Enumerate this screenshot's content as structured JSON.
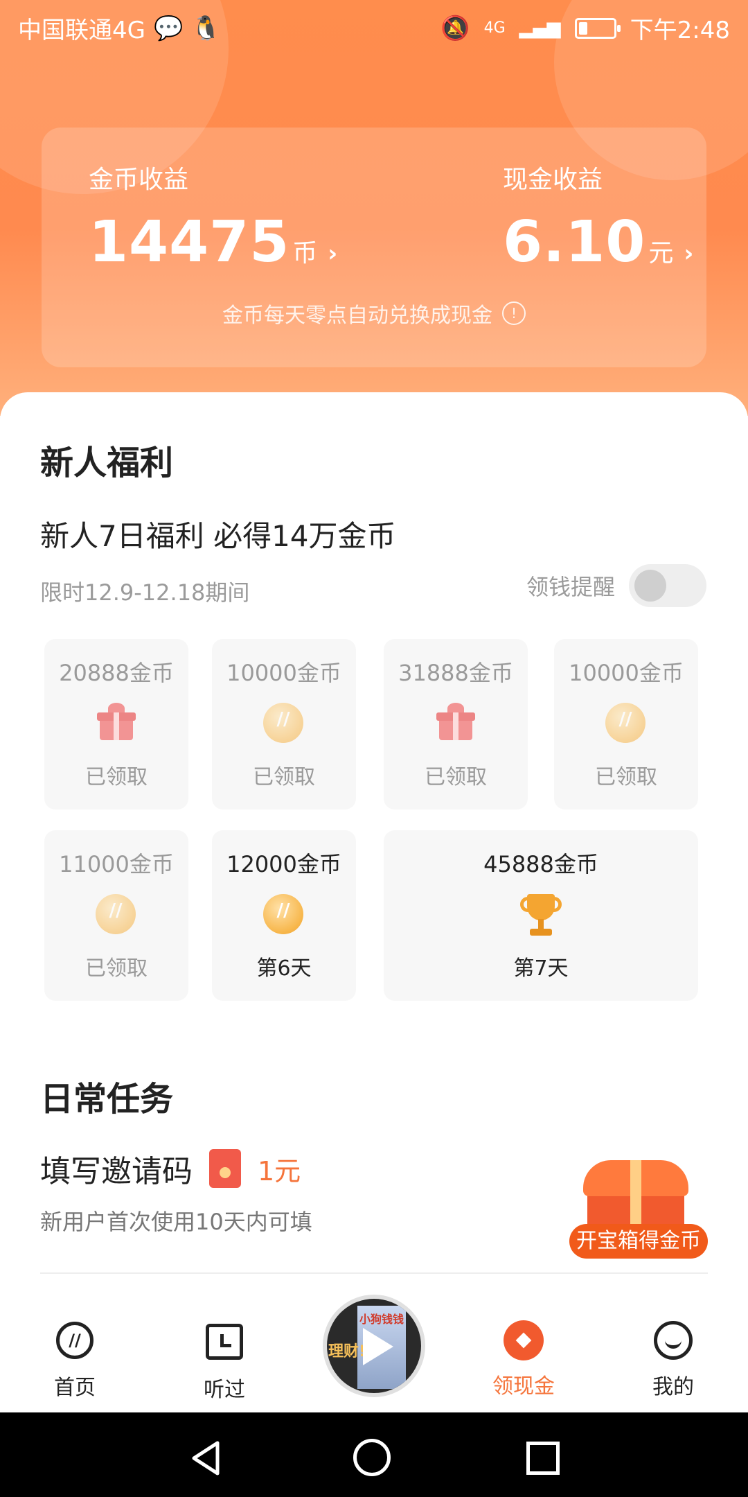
{
  "status_bar": {
    "carrier": "中国联通4G",
    "time": "下午2:48",
    "network": "4G"
  },
  "earnings": {
    "coins": {
      "label": "金币收益",
      "value": "14475",
      "unit": "币",
      "arrow": "›"
    },
    "cash": {
      "label": "现金收益",
      "value": "6.10",
      "unit": "元",
      "arrow": "›"
    },
    "note": "金币每天零点自动兑换成现金",
    "info_icon": "!"
  },
  "newbie": {
    "title": "新人福利",
    "subtitle": "新人7日福利 必得14万金币",
    "period": "限时12.9-12.18期间",
    "remind_label": "领钱提醒",
    "remind_enabled": false,
    "rewards": [
      {
        "amount": "20888金币",
        "status": "已领取",
        "icon": "gift-icon"
      },
      {
        "amount": "10000金币",
        "status": "已领取",
        "icon": "coin-icon"
      },
      {
        "amount": "31888金币",
        "status": "已领取",
        "icon": "gift-icon"
      },
      {
        "amount": "10000金币",
        "status": "已领取",
        "icon": "coin-icon"
      },
      {
        "amount": "11000金币",
        "status": "已领取",
        "icon": "coin-icon"
      },
      {
        "amount": "12000金币",
        "status": "第6天",
        "icon": "coin-icon"
      },
      {
        "amount": "45888金币",
        "status": "第7天",
        "icon": "trophy-icon"
      }
    ]
  },
  "daily": {
    "title": "日常任务",
    "invite": {
      "title": "填写邀请码",
      "reward": "1元",
      "desc": "新用户首次使用10天内可填",
      "chest_button": "开宝箱得金币"
    }
  },
  "player": {
    "cover_title": "小狗钱钱",
    "side_text": "理财!"
  },
  "tabbar": {
    "home": "首页",
    "history": "听过",
    "cash": "领现金",
    "me": "我的",
    "active": "领现金"
  },
  "colors": {
    "accent": "#f5743b",
    "header": "#ff8d4d",
    "red": "#f15a2e"
  }
}
